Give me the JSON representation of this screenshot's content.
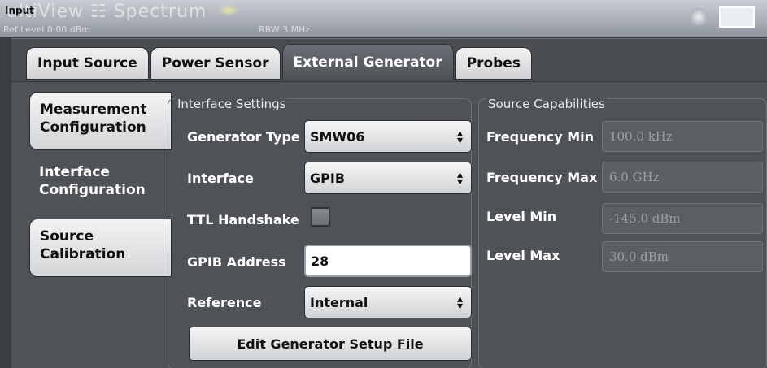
{
  "background": {
    "app_title": "ultiView  ☷  Spectrum",
    "ref_level": "Ref Level 0.00 dBm",
    "rbw": "RBW  3 MHz"
  },
  "dialog": {
    "title": "Input"
  },
  "top_tabs": [
    {
      "label": "Input Source",
      "active": false
    },
    {
      "label": "Power Sensor",
      "active": false
    },
    {
      "label": "External Generator",
      "active": true
    },
    {
      "label": "Probes",
      "active": false
    }
  ],
  "side_tabs": [
    {
      "label": "Measurement Configuration",
      "active": false
    },
    {
      "label": "Interface Configuration",
      "active": true
    },
    {
      "label": "Source Calibration",
      "active": false
    }
  ],
  "interface_settings": {
    "title": "Interface Settings",
    "generator_type": {
      "label": "Generator Type",
      "value": "SMW06"
    },
    "interface": {
      "label": "Interface",
      "value": "GPIB"
    },
    "ttl_handshake": {
      "label": "TTL Handshake",
      "checked": false
    },
    "gpib_address": {
      "label": "GPIB Address",
      "value": "28"
    },
    "reference": {
      "label": "Reference",
      "value": "Internal"
    },
    "edit_button": "Edit Generator Setup File"
  },
  "source_capabilities": {
    "title": "Source Capabilities",
    "freq_min": {
      "label": "Frequency Min",
      "value": "100.0 kHz"
    },
    "freq_max": {
      "label": "Frequency Max",
      "value": "6.0 GHz"
    },
    "level_min": {
      "label": "Level Min",
      "value": "-145.0 dBm"
    },
    "level_max": {
      "label": "Level Max",
      "value": "30.0 dBm"
    }
  },
  "colors": {
    "dialog_bg": "#4f5257",
    "active_tab_text": "#ffffff",
    "readonly_text": "#9aa0a6"
  }
}
